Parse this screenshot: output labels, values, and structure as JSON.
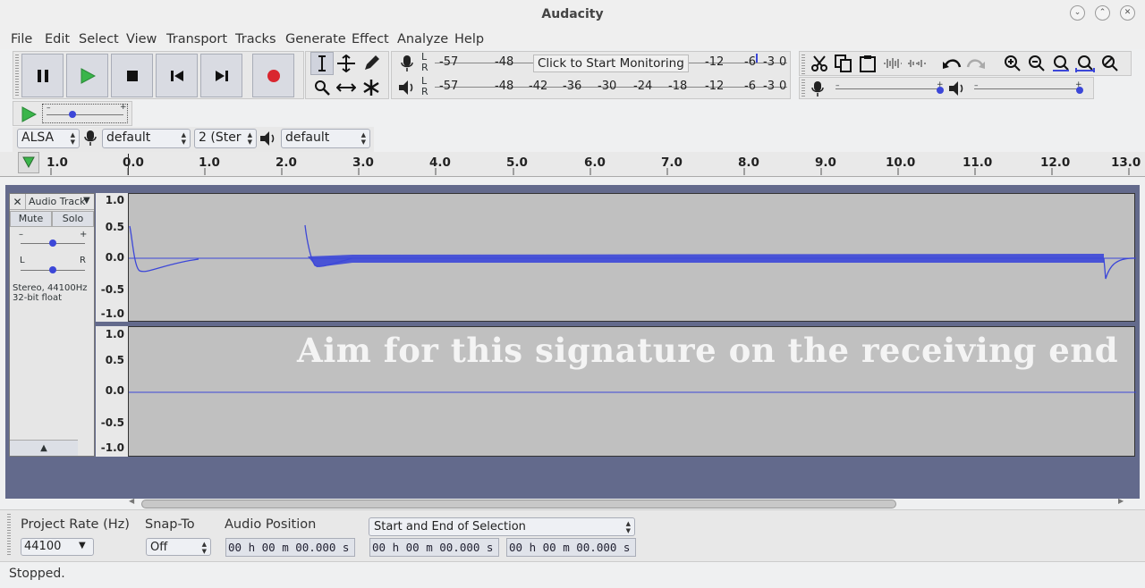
{
  "window": {
    "title": "Audacity"
  },
  "menu": [
    "File",
    "Edit",
    "Select",
    "View",
    "Transport",
    "Tracks",
    "Generate",
    "Effect",
    "Analyze",
    "Help"
  ],
  "meters": {
    "record_labels": [
      "-57",
      "-48",
      "3",
      "-12",
      "-6",
      "-3",
      "0"
    ],
    "playback_labels": [
      "-57",
      "-48",
      "-42",
      "-36",
      "-30",
      "-24",
      "-18",
      "-12",
      "-6",
      "-3",
      "0"
    ],
    "tooltip": "Click to Start Monitoring"
  },
  "device": {
    "host": "ALSA",
    "recording_device": "default",
    "channels": "2 (Ster",
    "playback_device": "default"
  },
  "ruler": {
    "labels": [
      "1.0",
      "0.0",
      "1.0",
      "2.0",
      "3.0",
      "4.0",
      "5.0",
      "6.0",
      "7.0",
      "8.0",
      "9.0",
      "10.0",
      "11.0",
      "12.0",
      "13.0"
    ]
  },
  "track": {
    "name": "Audio Track",
    "mute": "Mute",
    "solo": "Solo",
    "gain_minus": "–",
    "gain_plus": "+",
    "pan_left": "L",
    "pan_right": "R",
    "info_line1": "Stereo, 44100Hz",
    "info_line2": "32-bit float",
    "vscale": [
      "1.0",
      "0.5",
      "0.0",
      "-0.5",
      "-1.0"
    ]
  },
  "watermark": "Aim for this signature on the receiving end",
  "selection_toolbar": {
    "project_rate_label": "Project Rate (Hz)",
    "project_rate": "44100",
    "snap_to_label": "Snap-To",
    "snap_to": "Off",
    "audio_position_label": "Audio Position",
    "audio_position": "00 h 00 m 00.000 s",
    "selection_mode": "Start and End of Selection",
    "selection_start": "00 h 00 m 00.000 s",
    "selection_end": "00 h 00 m 00.000 s"
  },
  "status": "Stopped.",
  "colors": {
    "waveform": "#3c47d8",
    "record": "#d9262f",
    "play": "#3ab54a",
    "track_bg": "#636a8c"
  }
}
